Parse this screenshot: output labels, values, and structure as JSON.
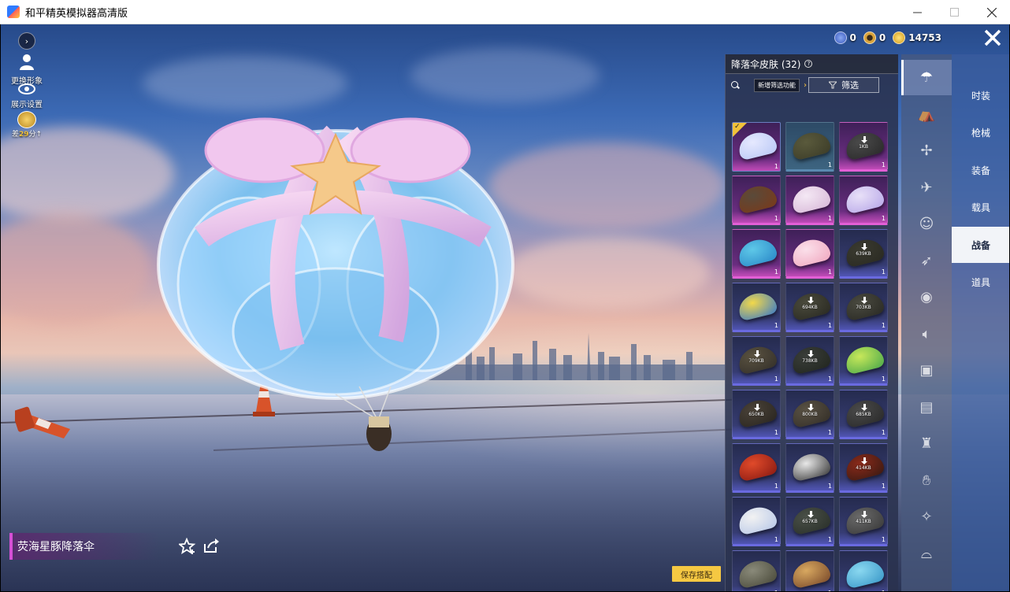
{
  "window": {
    "title": "和平精英模拟器高清版",
    "min_icon": "minimize-icon",
    "max_icon": "maximize-icon",
    "close_icon": "close-icon"
  },
  "left_toolbar": {
    "expand_icon": "chevron-right-icon",
    "change_look_label": "更换形象",
    "display_settings_label": "展示设置",
    "rank_badge": {
      "prefix": "差",
      "value": "29",
      "suffix": "分"
    }
  },
  "currency": [
    {
      "icon": "coin-blue-icon",
      "value": "0",
      "color": "#4a6fd6"
    },
    {
      "icon": "coin-gold-ring-icon",
      "value": "0",
      "color": "#d9a23a"
    },
    {
      "icon": "coin-yellow-icon",
      "value": "14753",
      "color": "#f2c23a"
    }
  ],
  "panel": {
    "title": "降落伞皮肤 (32)",
    "help_icon": "help-icon",
    "search_icon": "search-icon",
    "new_filter_label": "新增筛选功能",
    "filter_label": "筛选",
    "filter_icon": "filter-icon"
  },
  "items": [
    {
      "rarity": "purple",
      "count": "1",
      "size": "",
      "download": false,
      "selected": true,
      "colors": [
        "#e6e9ff",
        "#b9c8f5"
      ]
    },
    {
      "rarity": "teal",
      "count": "1",
      "size": "",
      "download": false,
      "selected": false,
      "colors": [
        "#5a5a3c",
        "#3c3c28"
      ]
    },
    {
      "rarity": "purple",
      "count": "1",
      "size": "1KB",
      "download": true,
      "selected": false,
      "colors": [
        "#4a4a4a",
        "#2a2a2a"
      ]
    },
    {
      "rarity": "purple",
      "count": "1",
      "size": "",
      "download": false,
      "selected": false,
      "colors": [
        "#5a4a3a",
        "#7a3a1a"
      ]
    },
    {
      "rarity": "purple",
      "count": "1",
      "size": "",
      "download": false,
      "selected": false,
      "colors": [
        "#f4e8f4",
        "#d8b8d8"
      ]
    },
    {
      "rarity": "purple",
      "count": "1",
      "size": "",
      "download": false,
      "selected": false,
      "colors": [
        "#e8e0f8",
        "#b8a8e8"
      ]
    },
    {
      "rarity": "purple",
      "count": "1",
      "size": "",
      "download": false,
      "selected": false,
      "colors": [
        "#5ec8e8",
        "#2a88c8"
      ]
    },
    {
      "rarity": "purple",
      "count": "1",
      "size": "",
      "download": false,
      "selected": false,
      "colors": [
        "#fbe0ea",
        "#f0a8c0"
      ]
    },
    {
      "rarity": "blue",
      "count": "1",
      "size": "639KB",
      "download": true,
      "selected": false,
      "colors": [
        "#3a3a30",
        "#2a2a22"
      ]
    },
    {
      "rarity": "blue",
      "count": "1",
      "size": "",
      "download": false,
      "selected": false,
      "colors": [
        "#f2d84a",
        "#3a7ac8"
      ]
    },
    {
      "rarity": "blue",
      "count": "1",
      "size": "694KB",
      "download": true,
      "selected": false,
      "colors": [
        "#4a4a3c",
        "#2a2a22"
      ]
    },
    {
      "rarity": "blue",
      "count": "1",
      "size": "703KB",
      "download": true,
      "selected": false,
      "colors": [
        "#4a4a40",
        "#2a2a24"
      ]
    },
    {
      "rarity": "blue",
      "count": "1",
      "size": "709KB",
      "download": true,
      "selected": false,
      "colors": [
        "#5a5240",
        "#34302a"
      ]
    },
    {
      "rarity": "blue",
      "count": "1",
      "size": "738KB",
      "download": true,
      "selected": false,
      "colors": [
        "#3a3e3a",
        "#22261f"
      ]
    },
    {
      "rarity": "blue",
      "count": "1",
      "size": "",
      "download": false,
      "selected": false,
      "colors": [
        "#c8e85a",
        "#4aa84a"
      ]
    },
    {
      "rarity": "blue",
      "count": "1",
      "size": "650KB",
      "download": true,
      "selected": false,
      "colors": [
        "#4a4238",
        "#2a2620"
      ]
    },
    {
      "rarity": "blue",
      "count": "1",
      "size": "800KB",
      "download": true,
      "selected": false,
      "colors": [
        "#5a5244",
        "#342f28"
      ]
    },
    {
      "rarity": "blue",
      "count": "1",
      "size": "685KB",
      "download": true,
      "selected": false,
      "colors": [
        "#4a4a4a",
        "#2a2a2a"
      ]
    },
    {
      "rarity": "blue",
      "count": "1",
      "size": "",
      "download": false,
      "selected": false,
      "colors": [
        "#e04a2a",
        "#8a1a12"
      ]
    },
    {
      "rarity": "blue",
      "count": "1",
      "size": "",
      "download": false,
      "selected": false,
      "colors": [
        "#e8e8e8",
        "#3a3a3a"
      ]
    },
    {
      "rarity": "blue",
      "count": "1",
      "size": "414KB",
      "download": true,
      "selected": false,
      "colors": [
        "#8a2a1a",
        "#3a1a12"
      ]
    },
    {
      "rarity": "blue",
      "count": "1",
      "size": "",
      "download": false,
      "selected": false,
      "colors": [
        "#f2f2f2",
        "#b8c8e8"
      ]
    },
    {
      "rarity": "blue",
      "count": "1",
      "size": "657KB",
      "download": true,
      "selected": false,
      "colors": [
        "#4a5048",
        "#2a302a"
      ]
    },
    {
      "rarity": "blue",
      "count": "1",
      "size": "411KB",
      "download": true,
      "selected": false,
      "colors": [
        "#6a6a6a",
        "#3a3a3a"
      ]
    },
    {
      "rarity": "blue",
      "count": "1",
      "size": "",
      "download": false,
      "selected": false,
      "colors": [
        "#8a8a7a",
        "#4a4a3a"
      ]
    },
    {
      "rarity": "blue",
      "count": "1",
      "size": "",
      "download": false,
      "selected": false,
      "colors": [
        "#d8a860",
        "#7a4a2a"
      ]
    },
    {
      "rarity": "blue",
      "count": "1",
      "size": "",
      "download": false,
      "selected": false,
      "colors": [
        "#8ad8f0",
        "#3a98c8"
      ]
    }
  ],
  "icon_tabs": [
    {
      "icon": "parachute-icon",
      "active": true
    },
    {
      "icon": "backpack-icon",
      "active": false
    },
    {
      "icon": "drone-icon",
      "active": false
    },
    {
      "icon": "plane-icon",
      "active": false
    },
    {
      "icon": "emote-face-icon",
      "active": false
    },
    {
      "icon": "glider-icon",
      "active": false
    },
    {
      "icon": "pet-icon",
      "active": false
    },
    {
      "icon": "speaker-icon",
      "active": false
    },
    {
      "icon": "radio-icon",
      "active": false
    },
    {
      "icon": "photo-frame-icon",
      "active": false
    },
    {
      "icon": "extinguisher-icon",
      "active": false
    },
    {
      "icon": "gesture-hand-icon",
      "active": false
    },
    {
      "icon": "magic-wand-icon",
      "active": false
    },
    {
      "icon": "ufo-icon",
      "active": false
    }
  ],
  "categories": [
    {
      "label": "时装",
      "active": false
    },
    {
      "label": "枪械",
      "active": false
    },
    {
      "label": "装备",
      "active": false
    },
    {
      "label": "载具",
      "active": false
    },
    {
      "label": "战备",
      "active": true
    },
    {
      "label": "道具",
      "active": false
    }
  ],
  "selected_item_name": "荧海星豚降落伞",
  "favorite_icon": "star-plus-icon",
  "share_icon": "share-icon",
  "save_button_label": "保存搭配",
  "top_close_icon": "close-icon"
}
